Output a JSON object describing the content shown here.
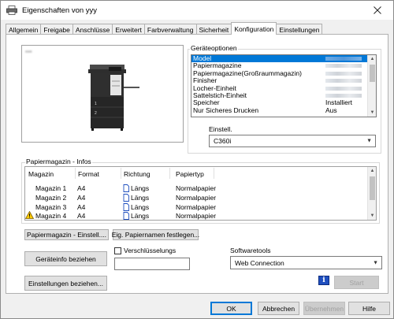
{
  "window": {
    "title": "Eigenschaften von yyy"
  },
  "tabs": [
    "Allgemein",
    "Freigabe",
    "Anschlüsse",
    "Erweitert",
    "Farbverwaltung",
    "Sicherheit",
    "Konfiguration",
    "Einstellungen"
  ],
  "active_tab": "Konfiguration",
  "preview": {
    "label": "▪▪▪"
  },
  "device_options": {
    "label": "Geräteoptionen",
    "items": [
      {
        "name": "Model",
        "value": ""
      },
      {
        "name": "Papiermagazine",
        "value": ""
      },
      {
        "name": "Papiermagazine(Großraummagazin)",
        "value": ""
      },
      {
        "name": "Finisher",
        "value": ""
      },
      {
        "name": "Locher-Einheit",
        "value": ""
      },
      {
        "name": "Sattelstich-Einheit",
        "value": ""
      },
      {
        "name": "Speicher",
        "value": "Installiert"
      },
      {
        "name": "Nur Sicheres Drucken",
        "value": "Aus"
      }
    ],
    "setting_label": "Einstell.",
    "setting_value": "C360i"
  },
  "tray_info": {
    "label": "Papiermagazin - Infos",
    "columns": [
      "Magazin",
      "Format",
      "Richtung",
      "Papiertyp"
    ],
    "rows": [
      {
        "tray": "Magazin 1",
        "format": "A4",
        "direction": "Längs",
        "type": "Normalpapier",
        "warning": false
      },
      {
        "tray": "Magazin 2",
        "format": "A4",
        "direction": "Längs",
        "type": "Normalpapier",
        "warning": false
      },
      {
        "tray": "Magazin 3",
        "format": "A4",
        "direction": "Längs",
        "type": "Normalpapier",
        "warning": false
      },
      {
        "tray": "Magazin 4",
        "format": "A4",
        "direction": "Längs",
        "type": "Normalpapier",
        "warning": true
      }
    ]
  },
  "buttons": {
    "tray_settings": "Papiermagazin - Einstell....",
    "paper_names": "Eig. Papiernamen festlegen...",
    "get_device_info": "Geräteinfo beziehen",
    "get_settings": "Einstellungen beziehen...",
    "start": "Start",
    "ok": "OK",
    "cancel": "Abbrechen",
    "apply": "Übernehmen",
    "help": "Hilfe"
  },
  "encryption": {
    "label": "Verschlüsselungs",
    "checked": false,
    "value": ""
  },
  "software_tools": {
    "label": "Softwaretools",
    "value": "Web Connection"
  },
  "colors": {
    "selection": "#0078d7",
    "window_bg": "#f0f0f0",
    "default_button_border": "#0078d7"
  }
}
